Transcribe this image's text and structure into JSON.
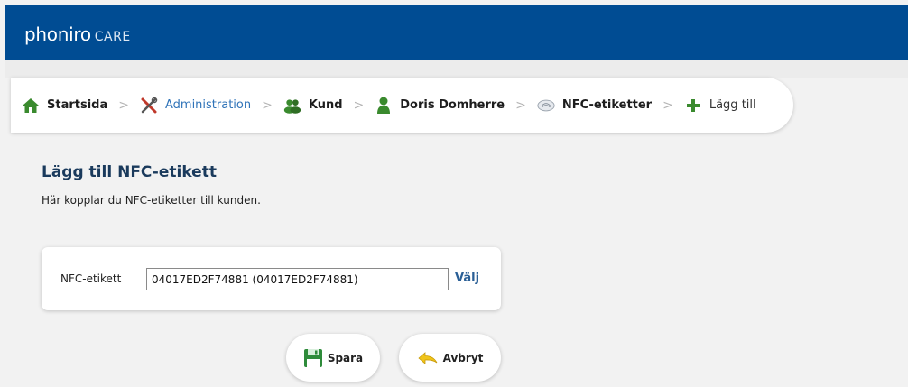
{
  "header": {
    "logo_main": "phoniro",
    "logo_sub": "CARE"
  },
  "breadcrumb": {
    "separator": ">",
    "items": [
      {
        "label": "Startsida",
        "icon": "home-icon"
      },
      {
        "label": "Administration",
        "icon": "tools-icon"
      },
      {
        "label": "Kund",
        "icon": "customer-group-icon"
      },
      {
        "label": "Doris Domherre",
        "icon": "person-icon"
      },
      {
        "label": "NFC-etiketter",
        "icon": "nfc-tag-icon"
      },
      {
        "label": "Lägg till",
        "icon": "plus-icon"
      }
    ]
  },
  "page": {
    "title": "Lägg till NFC-etikett",
    "description": "Här kopplar du NFC-etiketter till kunden."
  },
  "form": {
    "nfc_label": "NFC-etikett",
    "nfc_value": "04017ED2F74881 (04017ED2F74881)",
    "pick_label": "Välj"
  },
  "actions": {
    "save_label": "Spara",
    "cancel_label": "Avbryt"
  },
  "colors": {
    "header": "#004c93",
    "link": "#2f73b8",
    "green": "#3a8a2e",
    "title": "#1a3a5c"
  }
}
